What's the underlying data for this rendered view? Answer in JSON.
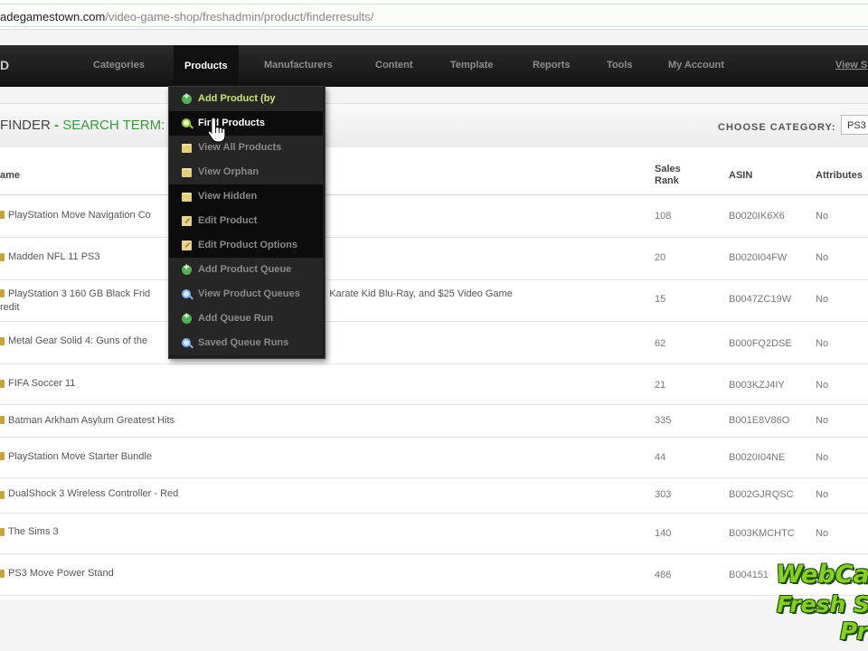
{
  "browser": {
    "url_domain": "adegamestown.com",
    "url_path": "/video-game-shop/freshadmin/product/finderresults/"
  },
  "topnav": {
    "brand_fragment": "D",
    "items": [
      "Categories",
      "Products",
      "Manufacturers",
      "Content",
      "Template",
      "Reports",
      "Tools",
      "My Account"
    ],
    "active": "Products",
    "view_link": "View S"
  },
  "heading": {
    "title_part1": "FINDER",
    "separator": "-",
    "title_part2": "SEARCH TERM: P",
    "choose_category_label": "CHOOSE CATEGORY:",
    "category_value": "PS3"
  },
  "table": {
    "columns": {
      "name": "ame",
      "sales_rank": "Sales\nRank",
      "asin": "ASIN",
      "attributes": "Attributes"
    },
    "rows": [
      {
        "name": "PlayStation Move Navigation Co",
        "rank": "108",
        "asin": "B0020IK6X6",
        "attr": "No"
      },
      {
        "name": "Madden NFL 11 PS3",
        "rank": "20",
        "asin": "B0020I04FW",
        "attr": "No"
      },
      {
        "name": "PlayStation 3 160 GB Black Frid                                      el Junk Shooter, Karate Kid Blu-Ray, and $25 Video Game",
        "name2": "redit",
        "rank": "15",
        "asin": "B0047ZC19W",
        "attr": "No"
      },
      {
        "name": "Metal Gear Solid 4: Guns of the",
        "rank": "62",
        "asin": "B000FQ2DSE",
        "attr": "No"
      },
      {
        "name": "FIFA Soccer 11",
        "rank": "21",
        "asin": "B003KZJ4IY",
        "attr": "No"
      },
      {
        "name": "Batman Arkham Asylum Greatest Hits",
        "rank": "335",
        "asin": "B001E8V86O",
        "attr": "No"
      },
      {
        "name": "PlayStation Move Starter Bundle",
        "rank": "44",
        "asin": "B0020I04NE",
        "attr": "No"
      },
      {
        "name": "DualShock 3 Wireless Controller - Red",
        "rank": "303",
        "asin": "B002GJRQSC",
        "attr": "No"
      },
      {
        "name": "The Sims 3",
        "rank": "140",
        "asin": "B003KMCHTC",
        "attr": "No"
      },
      {
        "name": "PS3 Move Power Stand",
        "rank": "486",
        "asin": "B004151",
        "attr": "No"
      }
    ]
  },
  "dropdown": {
    "items": [
      {
        "label": "Add Product (by",
        "icon": "plus-icon"
      },
      {
        "label": "Find Products",
        "icon": "search-icon"
      },
      {
        "label": "View All Products",
        "icon": "folder-icon"
      },
      {
        "label": "View Orphan",
        "icon": "folder-icon"
      },
      {
        "label": "View Hidden",
        "icon": "folder-icon"
      },
      {
        "label": "Edit Product",
        "icon": "edit-icon"
      },
      {
        "label": "Edit Product Options",
        "icon": "edit-icon"
      },
      {
        "label": "Add Product Queue",
        "icon": "plus-icon"
      },
      {
        "label": "View Product Queues",
        "icon": "search-icon"
      },
      {
        "label": "Add Queue Run",
        "icon": "plus-icon"
      },
      {
        "label": "Saved Queue Runs",
        "icon": "search-icon"
      }
    ]
  },
  "watermark": {
    "line1": "WebCas",
    "line2": "Fresh St",
    "line3": "Pr"
  },
  "colors": {
    "accent_green": "#3a9a3a",
    "nav_bg": "#1a1a1a",
    "menu_highlight": "#c9e86a"
  }
}
